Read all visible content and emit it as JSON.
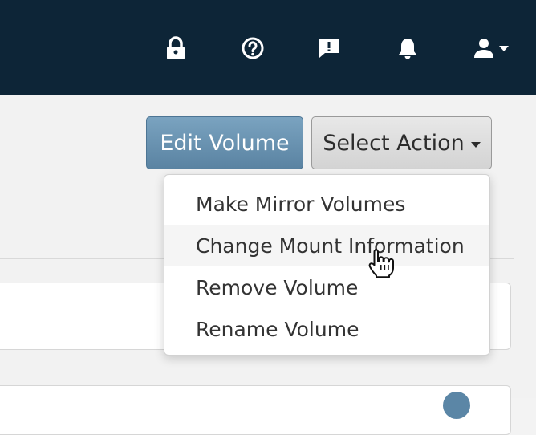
{
  "header": {
    "icons": [
      "lock-icon",
      "help-icon",
      "feedback-icon",
      "bell-icon",
      "user-icon",
      "caret-down-icon"
    ]
  },
  "toolbar": {
    "edit_label": "Edit Volume",
    "select_label": "Select Action"
  },
  "menu": {
    "items": [
      {
        "label": "Make Mirror Volumes"
      },
      {
        "label": "Change Mount Information"
      },
      {
        "label": "Remove Volume"
      },
      {
        "label": "Rename Volume"
      }
    ]
  },
  "colors": {
    "topbar": "#0d2537",
    "primary_button": "#6d96b5",
    "hover_row": "#f5f5f5"
  }
}
